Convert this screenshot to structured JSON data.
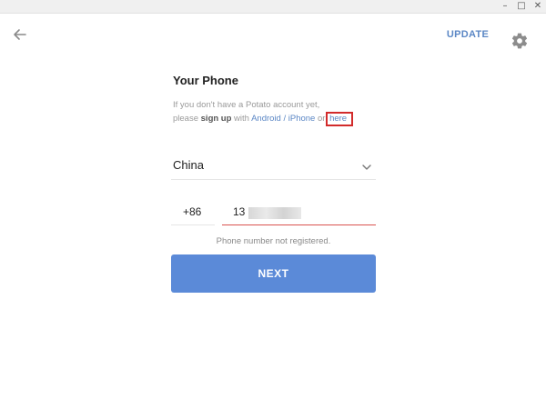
{
  "window": {
    "minimize_glyph": "–",
    "maximize_glyph": "□",
    "close_glyph": "✕"
  },
  "header": {
    "back_icon": "arrow-left-icon",
    "update_label": "UPDATE",
    "settings_icon": "gear-icon"
  },
  "form": {
    "title": "Your Phone",
    "info_line1": "If you don't have a Potato account yet,",
    "info_prefix": "please ",
    "info_bold": "sign up",
    "info_with": " with ",
    "info_link_platforms": "Android / iPhone",
    "info_or": " or ",
    "info_link_here": "here",
    "country": "China",
    "country_code": "+86",
    "phone_value": "13",
    "error_message": "Phone number not registered.",
    "next_label": "NEXT"
  },
  "colors": {
    "accent": "#5b8ad8",
    "link": "#5b87c5",
    "error_underline": "#d9534f",
    "highlight_box": "#d22b2b"
  }
}
